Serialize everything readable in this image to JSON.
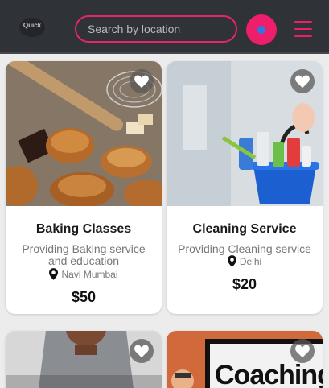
{
  "header": {
    "logo_text": "Quick",
    "logo_sub": "........",
    "search_placeholder": "Search by location"
  },
  "icons": {
    "favorite": "heart-icon",
    "location": "map-pin-icon",
    "menu": "hamburger-menu-icon",
    "search": "search-icon"
  },
  "colors": {
    "accent": "#ed1e6c",
    "header_bg": "#2f3237"
  },
  "cards": [
    {
      "title": "Baking Classes",
      "description": "Providing Baking service and education",
      "location": "Navi Mumbai",
      "price": "$50"
    },
    {
      "title": "Cleaning Service",
      "description": "Providing Cleaning service",
      "location": "Delhi",
      "price": "$20"
    },
    {
      "title": "",
      "description": "",
      "location": "",
      "price": ""
    },
    {
      "title": "",
      "description": "",
      "location": "",
      "price": "",
      "image_text": "Coaching"
    }
  ]
}
